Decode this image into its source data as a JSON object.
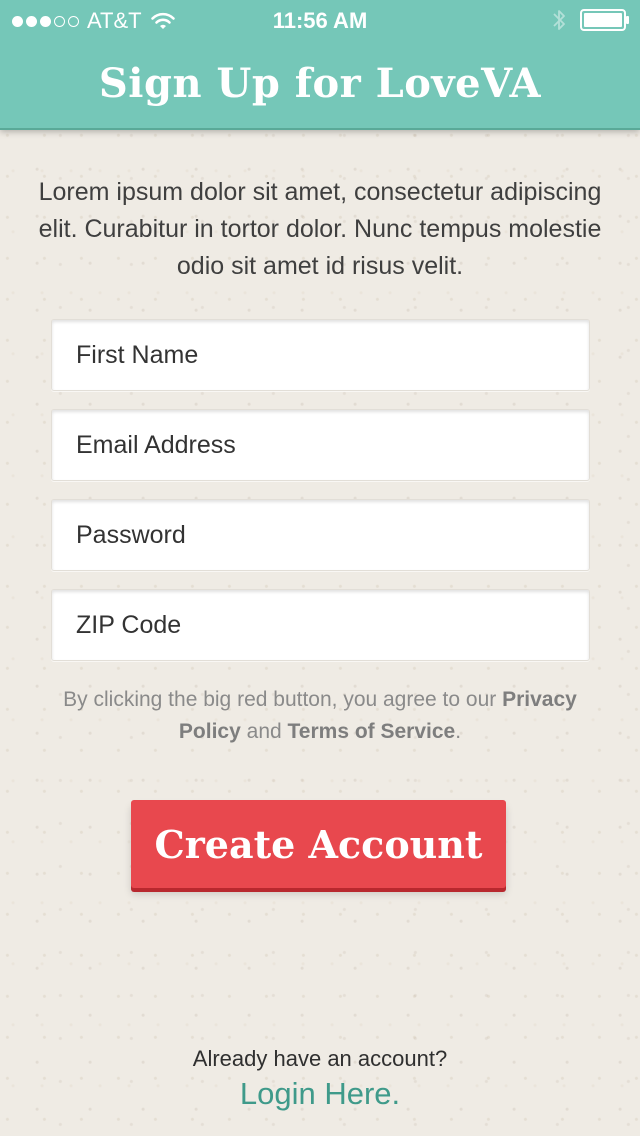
{
  "status_bar": {
    "signal_full": 3,
    "signal_empty": 2,
    "carrier": "AT&T",
    "time": "11:56 AM",
    "icons": [
      "wifi-icon",
      "bluetooth-icon",
      "battery-icon"
    ]
  },
  "header": {
    "title": "Sign Up for LoveVA",
    "background": "#75c7b8"
  },
  "intro_text": "Lorem ipsum dolor sit amet, consectetur adipiscing elit. Curabitur in tortor dolor. Nunc tempus molestie odio sit amet  id risus velit.",
  "form": {
    "first_name": {
      "placeholder": "First Name",
      "value": ""
    },
    "email": {
      "placeholder": "Email Address",
      "value": ""
    },
    "password": {
      "placeholder": "Password",
      "value": ""
    },
    "zip": {
      "placeholder": "ZIP Code",
      "value": ""
    }
  },
  "agreement": {
    "prefix": "By clicking the big red button, you agree to our",
    "privacy_link": "Privacy Policy",
    "conjunction": "and",
    "terms_link": "Terms of Service",
    "suffix": "."
  },
  "create_button": {
    "label": "Create Account",
    "color": "#e8484e"
  },
  "footer": {
    "question": "Already have an account?",
    "login_link": "Login Here.",
    "link_color": "#3f9a8a"
  }
}
